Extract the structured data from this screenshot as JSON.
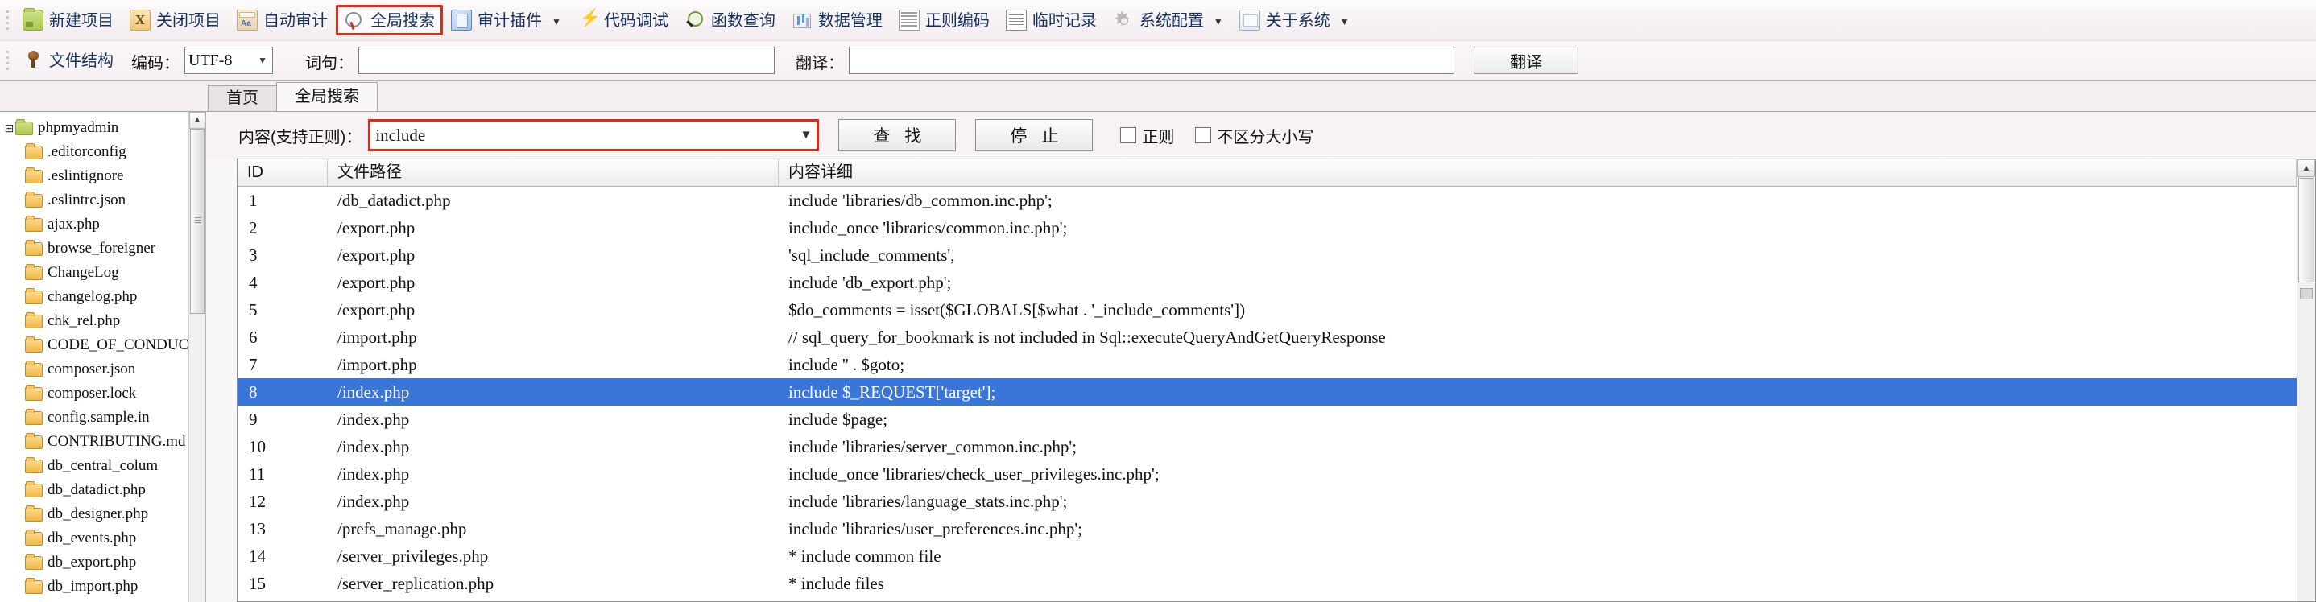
{
  "toolbar1": {
    "items": [
      {
        "label": "新建项目",
        "icon": "new-project-folder-icon",
        "icon_class": "ic-folder",
        "caret": false,
        "highlight": false
      },
      {
        "label": "关闭项目",
        "icon": "close-project-x-icon",
        "icon_class": "ic-x",
        "icon_text": "X",
        "caret": false,
        "highlight": false
      },
      {
        "label": "自动审计",
        "icon": "auto-audit-icon",
        "icon_class": "ic-aa",
        "caret": false,
        "highlight": false
      },
      {
        "label": "全局搜索",
        "icon": "global-search-icon",
        "icon_class": "ic-search",
        "caret": false,
        "highlight": true
      },
      {
        "label": "审计插件",
        "icon": "audit-plugin-icon",
        "icon_class": "ic-plugin",
        "caret": true,
        "highlight": false
      },
      {
        "label": "代码调试",
        "icon": "code-debug-bolt-icon",
        "icon_class": "ic-bolt",
        "caret": false,
        "highlight": false
      },
      {
        "label": "函数查询",
        "icon": "function-query-magnifier-icon",
        "icon_class": "ic-magnify",
        "caret": false,
        "highlight": false
      },
      {
        "label": "数据管理",
        "icon": "data-management-icon",
        "icon_class": "ic-db",
        "caret": false,
        "highlight": false
      },
      {
        "label": "正则编码",
        "icon": "regex-encode-icon",
        "icon_class": "ic-regex",
        "caret": false,
        "highlight": false
      },
      {
        "label": "临时记录",
        "icon": "temp-notes-icon",
        "icon_class": "ic-note",
        "caret": false,
        "highlight": false
      },
      {
        "label": "系统配置",
        "icon": "system-config-gear-icon",
        "icon_class": "ic-gear",
        "caret": true,
        "highlight": false
      },
      {
        "label": "关于系统",
        "icon": "about-system-icon",
        "icon_class": "ic-about",
        "caret": true,
        "highlight": false
      }
    ]
  },
  "toolbar2": {
    "file_structure": {
      "label": "文件结构",
      "icon": "file-structure-tree-icon"
    },
    "encoding_label": "编码：",
    "encoding_value": "UTF-8",
    "encoding_options": [
      "UTF-8"
    ],
    "phrase_label": "词句：",
    "phrase_value": "",
    "translate_label": "翻译：",
    "translate_value": "",
    "translate_button": "翻译"
  },
  "tabs": [
    {
      "label": "首页",
      "active": false
    },
    {
      "label": "全局搜索",
      "active": true
    }
  ],
  "search": {
    "content_label": "内容(支持正则)：",
    "content_value": "include",
    "content_options": [
      "include"
    ],
    "find_button": "查 找",
    "stop_button": "停 止",
    "regex_checkbox": {
      "label": "正则",
      "checked": false
    },
    "ignorecase_checkbox": {
      "label": "不区分大小写",
      "checked": false
    },
    "highlight_color": "#e02a14"
  },
  "tree": {
    "root": {
      "label": "phpmyadmin",
      "icon": "folder-root-icon",
      "expander": "-"
    },
    "items": [
      {
        "label": ".editorconfig",
        "icon": "folder-icon"
      },
      {
        "label": ".eslintignore",
        "icon": "folder-icon"
      },
      {
        "label": ".eslintrc.json",
        "icon": "folder-icon"
      },
      {
        "label": "ajax.php",
        "icon": "folder-icon"
      },
      {
        "label": "browse_foreigner",
        "icon": "folder-icon"
      },
      {
        "label": "ChangeLog",
        "icon": "folder-icon"
      },
      {
        "label": "changelog.php",
        "icon": "folder-icon"
      },
      {
        "label": "chk_rel.php",
        "icon": "folder-icon"
      },
      {
        "label": "CODE_OF_CONDUCT.",
        "icon": "folder-icon"
      },
      {
        "label": "composer.json",
        "icon": "folder-icon"
      },
      {
        "label": "composer.lock",
        "icon": "folder-icon"
      },
      {
        "label": "config.sample.in",
        "icon": "folder-icon"
      },
      {
        "label": "CONTRIBUTING.md",
        "icon": "folder-icon"
      },
      {
        "label": "db_central_colum",
        "icon": "folder-icon"
      },
      {
        "label": "db_datadict.php",
        "icon": "folder-icon"
      },
      {
        "label": "db_designer.php",
        "icon": "folder-icon"
      },
      {
        "label": "db_events.php",
        "icon": "folder-icon"
      },
      {
        "label": "db_export.php",
        "icon": "folder-icon"
      },
      {
        "label": "db_import.php",
        "icon": "folder-icon"
      }
    ]
  },
  "table": {
    "columns": [
      "ID",
      "文件路径",
      "内容详细"
    ],
    "selected_row_index": 7,
    "selection_color": "#3a76d8",
    "rows": [
      {
        "id": "1",
        "path": "/db_datadict.php",
        "detail": "include 'libraries/db_common.inc.php';"
      },
      {
        "id": "2",
        "path": "/export.php",
        "detail": "include_once 'libraries/common.inc.php';"
      },
      {
        "id": "3",
        "path": "/export.php",
        "detail": "'sql_include_comments',"
      },
      {
        "id": "4",
        "path": "/export.php",
        "detail": "include 'db_export.php';"
      },
      {
        "id": "5",
        "path": "/export.php",
        "detail": "$do_comments = isset($GLOBALS[$what . '_include_comments'])"
      },
      {
        "id": "6",
        "path": "/import.php",
        "detail": "// sql_query_for_bookmark is not included in Sql::executeQueryAndGetQueryResponse"
      },
      {
        "id": "7",
        "path": "/import.php",
        "detail": "include '' . $goto;"
      },
      {
        "id": "8",
        "path": "/index.php",
        "detail": "include $_REQUEST['target'];"
      },
      {
        "id": "9",
        "path": "/index.php",
        "detail": "include $page;"
      },
      {
        "id": "10",
        "path": "/index.php",
        "detail": "include 'libraries/server_common.inc.php';"
      },
      {
        "id": "11",
        "path": "/index.php",
        "detail": "include_once 'libraries/check_user_privileges.inc.php';"
      },
      {
        "id": "12",
        "path": "/index.php",
        "detail": "include 'libraries/language_stats.inc.php';"
      },
      {
        "id": "13",
        "path": "/prefs_manage.php",
        "detail": "include 'libraries/user_preferences.inc.php';"
      },
      {
        "id": "14",
        "path": "/server_privileges.php",
        "detail": "* include common file"
      },
      {
        "id": "15",
        "path": "/server_replication.php",
        "detail": "* include files"
      }
    ]
  }
}
